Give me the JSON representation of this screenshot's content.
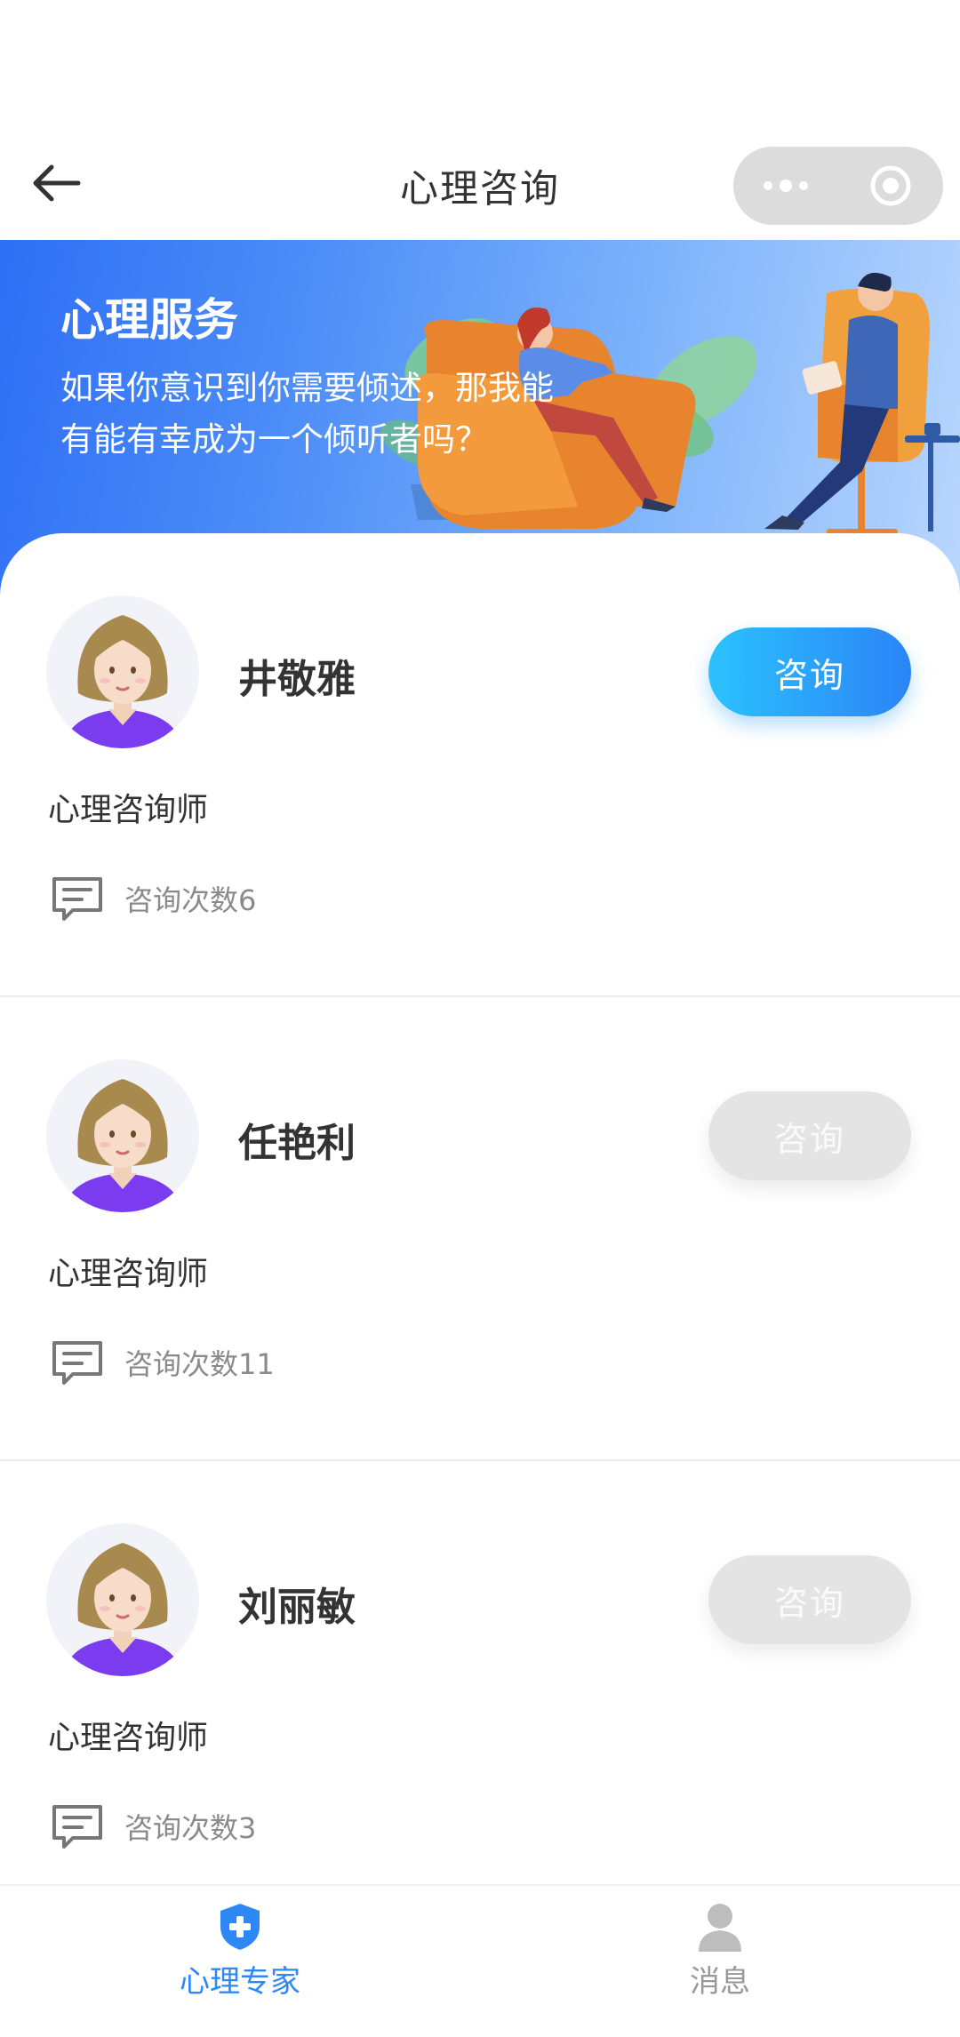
{
  "header": {
    "title": "心理咨询"
  },
  "banner": {
    "title": "心理服务",
    "text": "如果你意识到你需要倾述，那我能有能有幸成为一个倾听者吗？"
  },
  "counselors": [
    {
      "name": "井敬雅",
      "role": "心理咨询师",
      "count": "咨询次数6",
      "button": "咨询",
      "button_state": "active"
    },
    {
      "name": "任艳利",
      "role": "心理咨询师",
      "count": "咨询次数11",
      "button": "咨询",
      "button_state": "disabled"
    },
    {
      "name": "刘丽敏",
      "role": "心理咨询师",
      "count": "咨询次数3",
      "button": "咨询",
      "button_state": "disabled"
    }
  ],
  "tabbar": {
    "items": [
      {
        "label": "心理专家",
        "icon": "shield-plus-icon",
        "active": true
      },
      {
        "label": "消息",
        "icon": "user-icon",
        "active": false
      }
    ]
  },
  "colors": {
    "accent": "#2d88f6",
    "banner_start": "#2f6ff5",
    "banner_end": "#b9d6fd",
    "disabled_button": "#e4e4e4"
  }
}
